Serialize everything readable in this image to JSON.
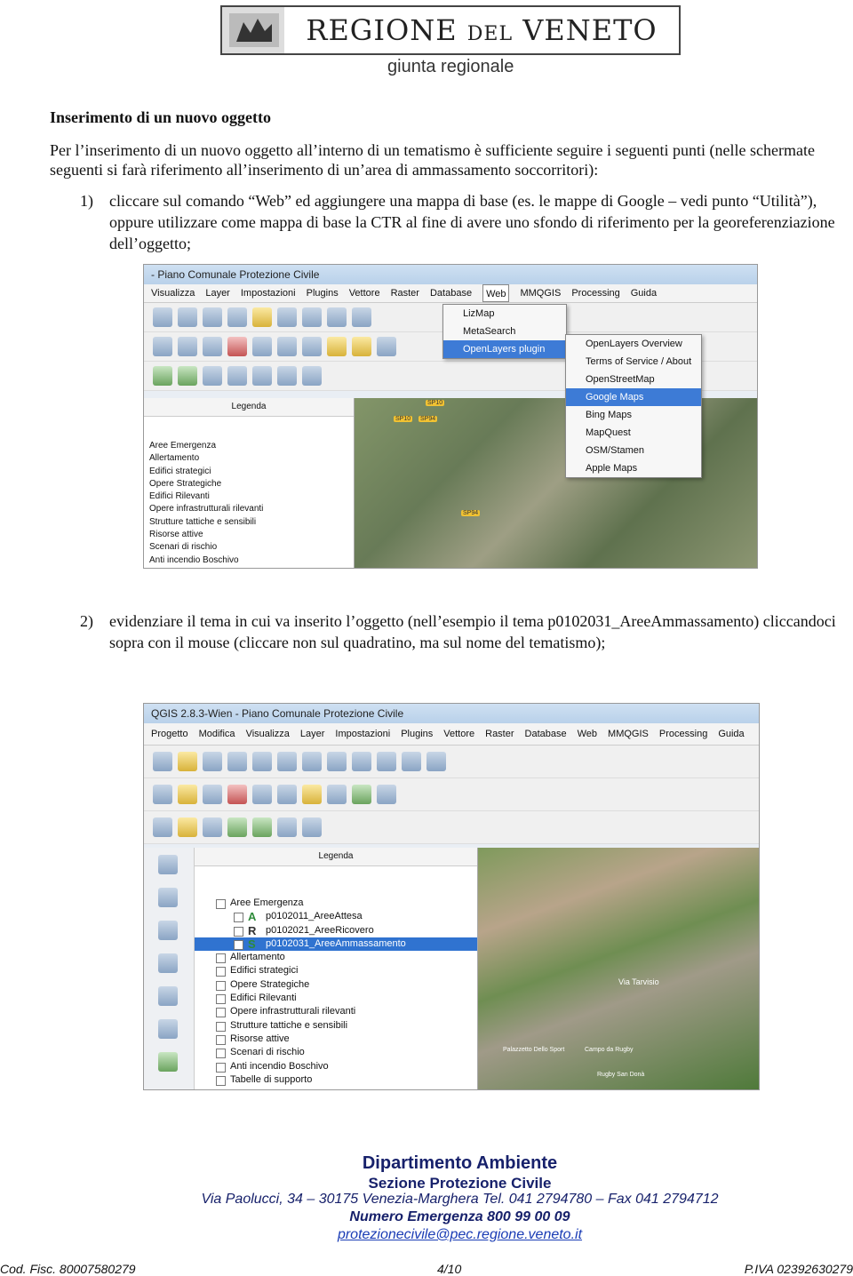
{
  "header": {
    "brand_main": "REGIONE",
    "brand_small": "DEL",
    "brand_end": "VENETO",
    "subtitle": "giunta regionale"
  },
  "heading": "Inserimento di un nuovo oggetto",
  "intro": "Per l’inserimento di un nuovo oggetto all’interno di un tematismo è sufficiente seguire i seguenti punti (nelle schermate seguenti si farà riferimento all’inserimento di un’area di ammassamento soccorritori):",
  "steps": [
    {
      "num": "1)",
      "text": "cliccare sul comando “Web” ed aggiungere una mappa di base (es. le mappe di Google – vedi punto “Utilità”), oppure utilizzare come mappa di base la CTR al fine di avere uno sfondo di riferimento per la georeferenziazione dell’oggetto;"
    },
    {
      "num": "2)",
      "text": "evidenziare il tema in cui va inserito l’oggetto (nell’esempio il tema p0102031_AreeAmmassamento) cliccandoci sopra con il mouse (cliccare non sul quadratino, ma sul nome del tematismo);"
    }
  ],
  "screenshot1": {
    "title": "- Piano Comunale Protezione Civile",
    "menu": [
      "Visualizza",
      "Layer",
      "Impostazioni",
      "Plugins",
      "Vettore",
      "Raster",
      "Database",
      "Web",
      "MMQGIS",
      "Processing",
      "Guida"
    ],
    "web_menu": [
      "LizMap",
      "MetaSearch",
      "OpenLayers plugin"
    ],
    "openlayers_menu": [
      "OpenLayers Overview",
      "Terms of Service / About",
      "OpenStreetMap",
      "Google Maps",
      "Bing Maps",
      "MapQuest",
      "OSM/Stamen",
      "Apple Maps"
    ],
    "legend_title": "Legenda",
    "layers": [
      "Aree Emergenza",
      "Allertamento",
      "Edifici strategici",
      "Opere Strategiche",
      "Edifici Rilevanti",
      "Opere infrastrutturali rilevanti",
      "Strutture tattiche e sensibili",
      "Risorse attive",
      "Scenari di rischio",
      "Anti incendio Boschivo"
    ],
    "road_labels": [
      "SP10",
      "SP10",
      "SP94",
      "SP94"
    ]
  },
  "screenshot2": {
    "title": "QGIS 2.8.3-Wien - Piano Comunale Protezione Civile",
    "menu": [
      "Progetto",
      "Modifica",
      "Visualizza",
      "Layer",
      "Impostazioni",
      "Plugins",
      "Vettore",
      "Raster",
      "Database",
      "Web",
      "MMQGIS",
      "Processing",
      "Guida"
    ],
    "legend_title": "Legenda",
    "layers": [
      {
        "label": "Aree Emergenza",
        "badge": ""
      },
      {
        "label": "p0102011_AreeAttesa",
        "badge": "A"
      },
      {
        "label": "p0102021_AreeRicovero",
        "badge": "R"
      },
      {
        "label": "p0102031_AreeAmmassamento",
        "badge": "S"
      },
      {
        "label": "Allertamento",
        "badge": ""
      },
      {
        "label": "Edifici strategici",
        "badge": ""
      },
      {
        "label": "Opere Strategiche",
        "badge": ""
      },
      {
        "label": "Edifici Rilevanti",
        "badge": ""
      },
      {
        "label": "Opere infrastrutturali rilevanti",
        "badge": ""
      },
      {
        "label": "Strutture tattiche e sensibili",
        "badge": ""
      },
      {
        "label": "Risorse attive",
        "badge": ""
      },
      {
        "label": "Scenari di rischio",
        "badge": ""
      },
      {
        "label": "Anti incendio Boschivo",
        "badge": ""
      },
      {
        "label": "Tabelle di supporto",
        "badge": ""
      }
    ],
    "map_labels": [
      "Via Tarvisio",
      "Palazzetto Dello Sport",
      "Campo da Rugby",
      "Rugby San Donà"
    ]
  },
  "footer": {
    "dept": "Dipartimento Ambiente",
    "section": "Sezione Protezione Civile",
    "address": "Via Paolucci, 34 – 30175 Venezia-Marghera Tel. 041 2794780 – Fax 041 2794712",
    "emergency": "Numero Emergenza 800 99 00 09",
    "email": "protezionecivile@pec.regione.veneto.it",
    "cod_fisc": "Cod. Fisc. 80007580279",
    "page": "4/10",
    "piva": "P.IVA 02392630279"
  },
  "colors": {
    "footer_blue": "#17216b",
    "selection_blue": "#3d7bd6"
  }
}
